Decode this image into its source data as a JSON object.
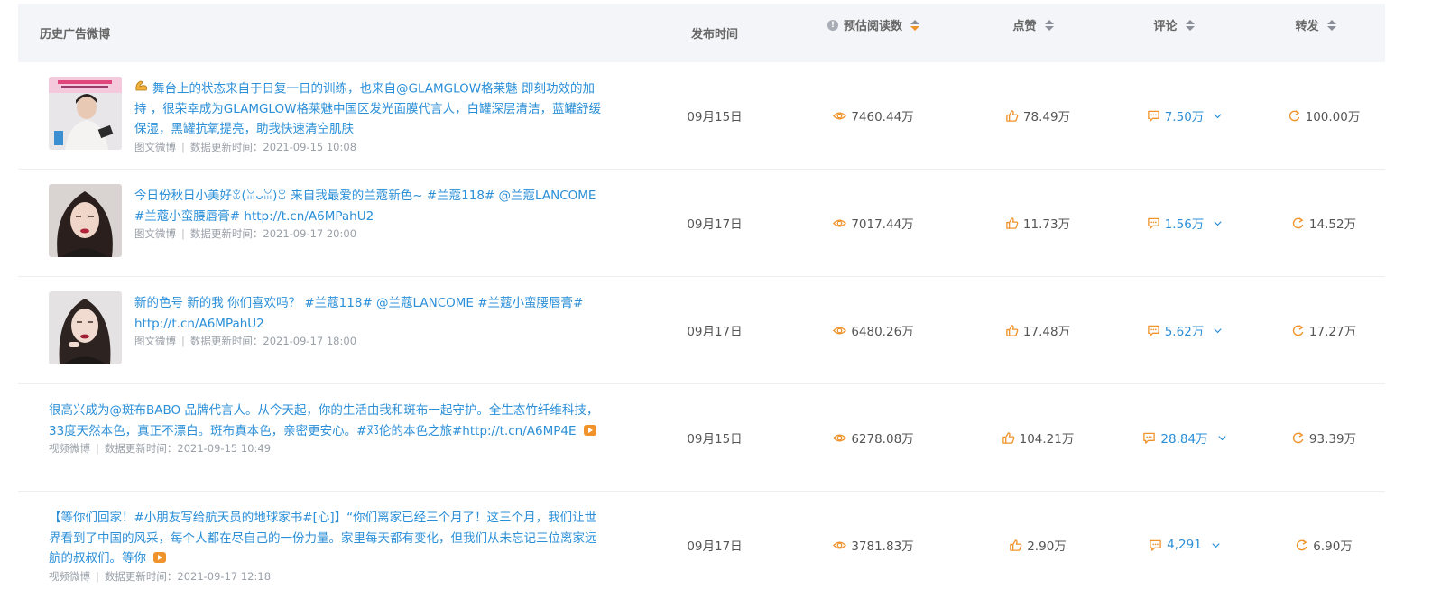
{
  "header": {
    "col_post": "历史广告微博",
    "col_time": "发布时间",
    "col_reads": "预估阅读数",
    "col_likes": "点赞",
    "col_comments": "评论",
    "col_reposts": "转发",
    "info_glyph": "!"
  },
  "rows": [
    {
      "text": "舞台上的状态来自于日复一日的训练，也来自@GLAMGLOW格莱魅  即刻功效的加持 ，很荣幸成为GLAMGLOW格莱魅中国区发光面膜代言人，白罐深层清洁，蓝罐舒缓保湿，黑罐抗氧提亮，助我快速清空肌肤",
      "type": "图文微博",
      "updated_label": "数据更新时间：",
      "updated": "2021-09-15 10:08",
      "date": "09月15日",
      "reads": "7460.44万",
      "likes": "78.49万",
      "comments": "7.50万",
      "reposts": "100.00万"
    },
    {
      "text": "今日份秋日小美好ꒃ(ꈍᴗꈍ)ꒃ 来自我最爱的兰蔻新色~ #兰蔻118# @兰蔻LANCOME #兰蔻小蛮腰唇膏# http://t.cn/A6MPahU2",
      "type": "图文微博",
      "updated_label": "数据更新时间：",
      "updated": "2021-09-17 20:00",
      "date": "09月17日",
      "reads": "7017.44万",
      "likes": "11.73万",
      "comments": "1.56万",
      "reposts": "14.52万"
    },
    {
      "text": "新的色号 新的我 你们喜欢吗？ #兰蔻118# @兰蔻LANCOME #兰蔻小蛮腰唇膏# http://t.cn/A6MPahU2",
      "type": "图文微博",
      "updated_label": "数据更新时间：",
      "updated": "2021-09-17 18:00",
      "date": "09月17日",
      "reads": "6480.26万",
      "likes": "17.48万",
      "comments": "5.62万",
      "reposts": "17.27万"
    },
    {
      "text": "很高兴成为@斑布BABO 品牌代言人。从今天起，你的生活由我和斑布一起守护。全生态竹纤维科技，33度天然本色，真正不漂白。斑布真本色，亲密更安心。#邓伦的本色之旅#http://t.cn/A6MP4E",
      "type": "视频微博",
      "updated_label": "数据更新时间：",
      "updated": "2021-09-15 10:49",
      "date": "09月15日",
      "reads": "6278.08万",
      "likes": "104.21万",
      "comments": "28.84万",
      "reposts": "93.39万"
    },
    {
      "text": "【等你们回家！#小朋友写给航天员的地球家书#[心]】“你们离家已经三个月了！这三个月，我们让世界看到了中国的风采，每个人都在尽自己的一份力量。家里每天都有变化，但我们从未忘记三位离家远航的叔叔们。等你",
      "type": "视频微博",
      "updated_label": "数据更新时间：",
      "updated": "2021-09-17 12:18",
      "date": "09月17日",
      "reads": "3781.83万",
      "likes": "2.90万",
      "comments": "4,291",
      "reposts": "6.90万"
    }
  ],
  "colors": {
    "link": "#2b8fd8",
    "accent": "#f0932b",
    "header_bg": "#f4f5f8"
  },
  "icons": {
    "reads": "eye-icon",
    "likes": "thumbs-up-icon",
    "comments": "comment-bubble-icon",
    "reposts": "repost-arrow-icon",
    "expand": "chevron-down-icon",
    "video": "video-badge-icon"
  }
}
